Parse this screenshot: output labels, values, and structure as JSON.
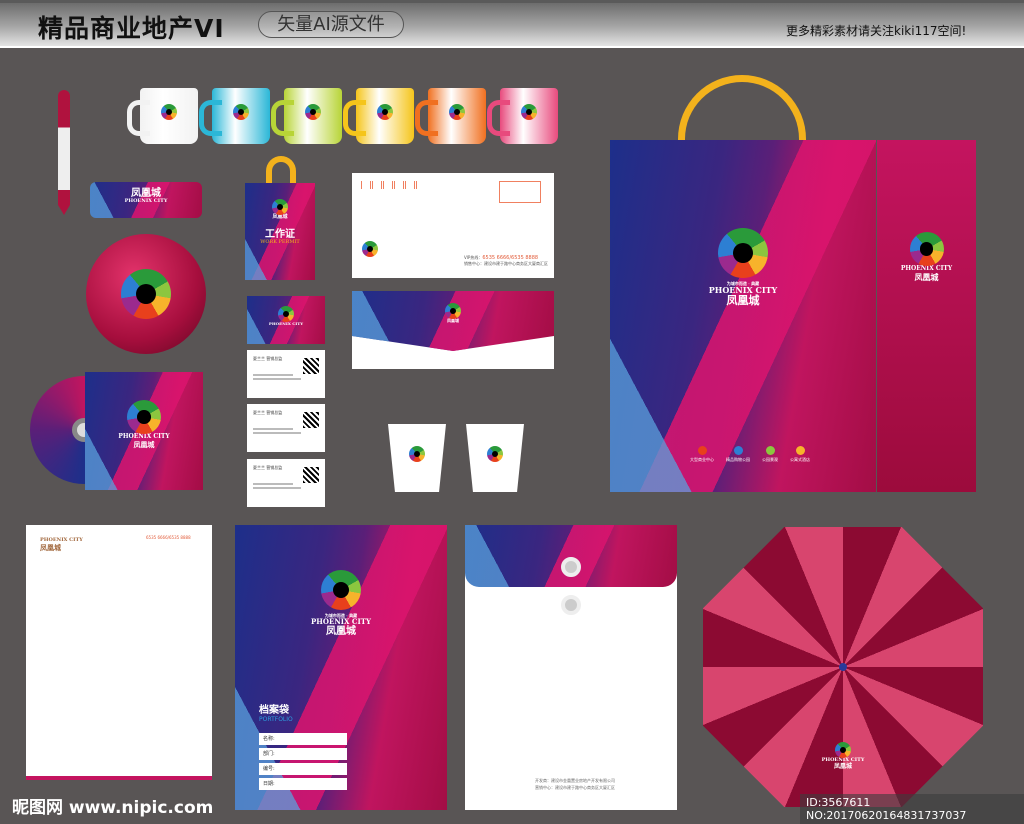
{
  "header": {
    "title": "精品商业地产VI",
    "badge": "矢量AI源文件",
    "promo": "更多精彩素材请关注kiki117空间!"
  },
  "brand": {
    "slogan": "为城市而造 · 典藏",
    "name_en": "PHOENIX CITY",
    "name_cn": "凤凰城"
  },
  "mug_colors": [
    "#f2f2f2",
    "#2bb7d7",
    "#b8d437",
    "#f5c51b",
    "#f07020",
    "#e84a7d"
  ],
  "work_permit": {
    "title": "工作证",
    "subtitle": "WORK PERMIT"
  },
  "envelope": {
    "phone_label": "VIP热线：",
    "phone": "6535 6666/6535 8888",
    "address": "销售中心：建设市建于路中心商务区大厦商汇区"
  },
  "bag": {
    "services": [
      "大型商业中心",
      "精品购物公园",
      "公园景观",
      "公寓式酒店"
    ]
  },
  "folder": {
    "title": "档案袋",
    "subtitle": "PORTFOLIO",
    "fields": [
      "名称:",
      "部门:",
      "编号:",
      "日期:"
    ]
  },
  "letterhead": {
    "phone": "6535 6666/6535 8888"
  },
  "business_card": {
    "name": "夏兰兰",
    "role": "营销总监"
  },
  "file_bag": {
    "footer1": "开发商：建设市金凰置业房地产开发有限公司",
    "footer2": "营销中心：建设市建于路中心商务区大厦汇区"
  },
  "watermark": {
    "site": "昵图网 www.nipic.com",
    "id": "ID:3567611 NO:20170620164831737037"
  }
}
